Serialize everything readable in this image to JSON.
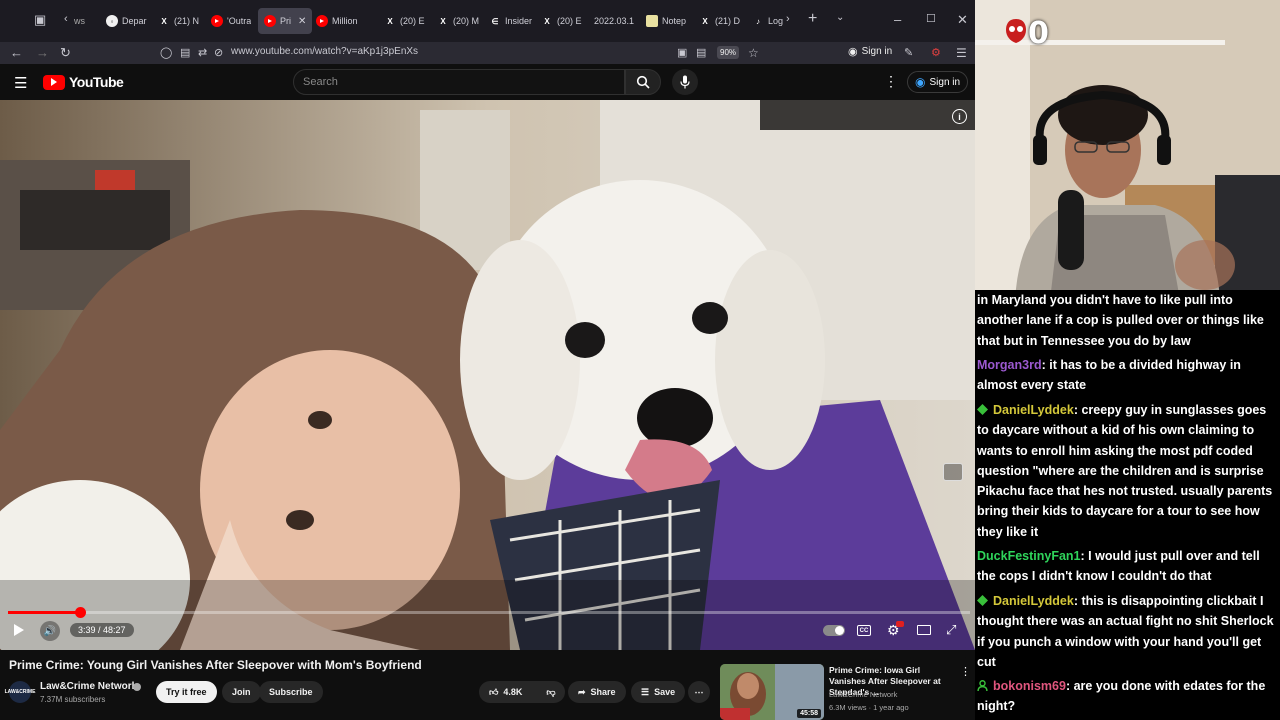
{
  "browser": {
    "tabs": [
      {
        "label": "Depar",
        "favicon": "globe-icon"
      },
      {
        "label": "(21) N",
        "favicon": "x-icon"
      },
      {
        "label": "'Outra",
        "favicon": "youtube-icon"
      },
      {
        "label": "Pri",
        "favicon": "youtube-icon",
        "active": true
      },
      {
        "label": "Million",
        "favicon": "youtube-icon"
      },
      {
        "label": "(20) E",
        "favicon": "x-icon"
      },
      {
        "label": "(20) M",
        "favicon": "x-icon"
      },
      {
        "label": "Insider",
        "favicon": "insider-icon"
      },
      {
        "label": "(20) E",
        "favicon": "x-icon"
      },
      {
        "label": "2022.03.1",
        "favicon": "page-icon"
      },
      {
        "label": "Notep",
        "favicon": "note-icon"
      },
      {
        "label": "(21) D",
        "favicon": "x-icon"
      },
      {
        "label": "Log",
        "favicon": "tiktok-icon"
      }
    ],
    "first_tab_partial": "ws",
    "url": "www.youtube.com/watch?v=aKp1j3pEnXs",
    "zoom": "90%",
    "sign_in": "Sign in"
  },
  "yt": {
    "logo_text": "YouTube",
    "search_placeholder": "Search",
    "sign_in": "Sign in",
    "brand_color": "#ff0000"
  },
  "player": {
    "time": "3:39 / 48:27",
    "progress_fraction": 0.0753,
    "autoplay": true
  },
  "video": {
    "title": "Prime Crime: Young Girl Vanishes After Sleepover with Mom's Boyfriend",
    "channel": "Law&Crime Network",
    "channel_avatar_text": "LAW&CRIME",
    "subscribers": "7.37M subscribers",
    "try_label": "Try it free",
    "join_label": "Join",
    "subscribe_label": "Subscribe",
    "likes": "4.8K",
    "share_label": "Share",
    "save_label": "Save"
  },
  "recommended": {
    "title": "Prime Crime: Iowa Girl Vanishes After Sleepover at Stepdad's ...",
    "channel": "Law&Crime Network",
    "meta": "6.3M views · 1 year ago",
    "duration": "45:58"
  },
  "webcam": {
    "counter": "0"
  },
  "chat": {
    "messages": [
      {
        "user": "",
        "text": "in Maryland you didn't have to like pull into another lane if a cop is pulled over or things like that but in Tennessee you do by law",
        "color": "#ffffff",
        "badge": ""
      },
      {
        "user": "Morgan3rd",
        "text": ": it has to be a divided highway in almost every state",
        "color": "#9b59d0",
        "badge": ""
      },
      {
        "user": "DanielLyddek",
        "text": ": creepy guy in sunglasses goes to daycare without a kid of his own claiming to wants to enroll him asking the most pdf coded question \"where are the children and is surprise Pikachu face that hes not trusted. usually parents bring their kids to daycare for a tour to see how they like it",
        "color": "#d4c83a",
        "badge": "diamond"
      },
      {
        "user": "DuckFestinyFan1",
        "text": ": I would just pull over and tell the cops I didn't know I couldn't do that",
        "color": "#2fd45b",
        "badge": ""
      },
      {
        "user": "DanielLyddek",
        "text": ": this is disappointing clickbait I thought there was an actual fight no shit Sherlock if you punch a window with your hand you'll get cut",
        "color": "#d4c83a",
        "badge": "diamond"
      },
      {
        "user": "bokonism69",
        "text": ": are you done with edates for the night?",
        "color": "#e0567e",
        "badge": "person"
      }
    ]
  }
}
